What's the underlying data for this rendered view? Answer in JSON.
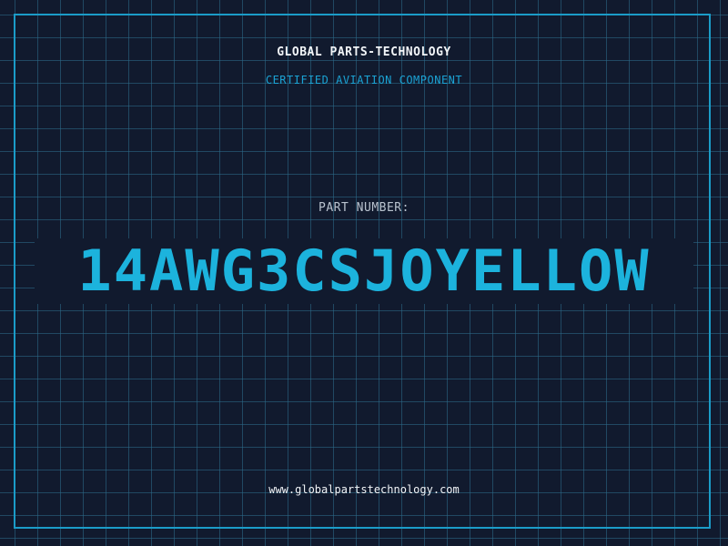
{
  "header": {
    "company_name": "GLOBAL PARTS-TECHNOLOGY",
    "tagline": "CERTIFIED AVIATION COMPONENT"
  },
  "part": {
    "label": "PART NUMBER:",
    "number": "14AWG3CSJOYELLOW"
  },
  "footer": {
    "website": "www.globalpartstechnology.com"
  },
  "colors": {
    "background": "#111a2e",
    "grid": "#2d6e8c",
    "accent": "#1cb3dd",
    "text": "#f2f5f8"
  }
}
